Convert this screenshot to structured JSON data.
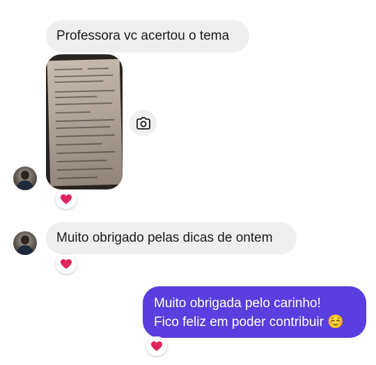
{
  "messages": [
    {
      "type": "text",
      "direction": "incoming",
      "text": "Professora vc acertou o tema"
    },
    {
      "type": "image",
      "direction": "incoming",
      "content": "photo of a printed exam sheet",
      "reaction": "heart"
    },
    {
      "type": "text",
      "direction": "incoming",
      "text": "Muito obrigado pelas dicas de ontem",
      "reaction": "heart"
    },
    {
      "type": "text",
      "direction": "outgoing",
      "lines": [
        "Muito obrigada pelo carinho!",
        "Fico feliz em poder contribuir ☺️"
      ],
      "reaction": "heart"
    }
  ],
  "colors": {
    "incoming_bubble": "#efefef",
    "outgoing_bubble": "#5b3ee0",
    "heart": "#e0245e"
  },
  "icons": {
    "camera": "camera-icon",
    "reaction": "heart-icon"
  }
}
